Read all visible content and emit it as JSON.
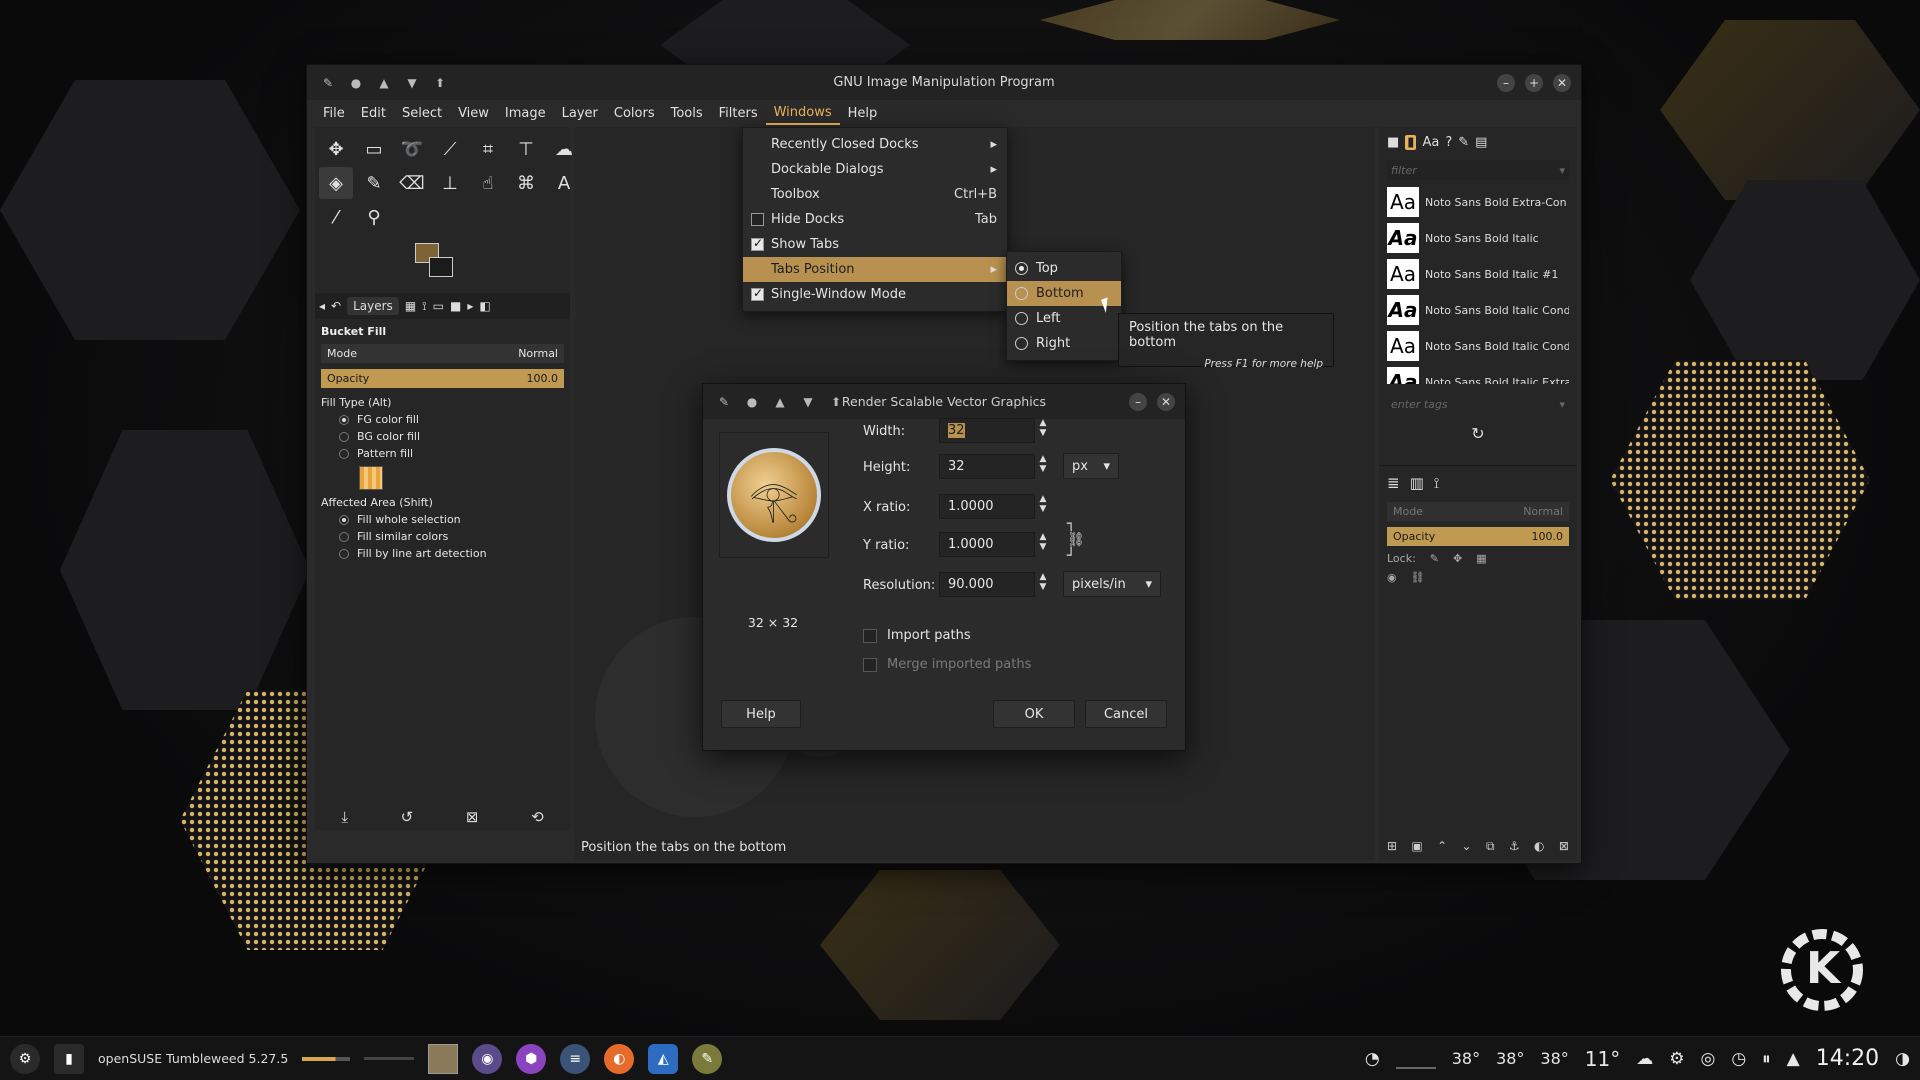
{
  "window": {
    "title": "GNU Image Manipulation Program"
  },
  "menubar": [
    "File",
    "Edit",
    "Select",
    "View",
    "Image",
    "Layer",
    "Colors",
    "Tools",
    "Filters",
    "Windows",
    "Help"
  ],
  "left_dock": {
    "tab_label": "Layers",
    "tool_name": "Bucket Fill",
    "mode_label": "Mode",
    "mode_value": "Normal",
    "opacity_label": "Opacity",
    "opacity_value": "100.0",
    "fill_type_label": "Fill Type  (Alt)",
    "fill_options": [
      "FG color fill",
      "BG color fill",
      "Pattern fill"
    ],
    "affected_label": "Affected Area  (Shift)",
    "affected_options": [
      "Fill whole selection",
      "Fill similar colors",
      "Fill by line art detection"
    ]
  },
  "windows_menu": {
    "items": [
      {
        "label": "Recently Closed Docks",
        "accel": "▸"
      },
      {
        "label": "Dockable Dialogs",
        "accel": "▸"
      },
      {
        "label": "Toolbox",
        "accel": "Ctrl+B"
      },
      {
        "label": "Hide Docks",
        "accel": "Tab"
      },
      {
        "label": "Show Tabs",
        "accel": ""
      },
      {
        "label": "Tabs Position",
        "accel": "▸"
      },
      {
        "label": "Single-Window Mode",
        "accel": ""
      }
    ]
  },
  "tabs_position_submenu": [
    "Top",
    "Bottom",
    "Left",
    "Right"
  ],
  "tooltip": {
    "text": "Position the tabs on the bottom",
    "help": "Press F1 for more help"
  },
  "canvas_status": "Position the tabs on the bottom",
  "fonts_panel": {
    "filter_placeholder": "filter",
    "tags_placeholder": "enter tags",
    "fonts": [
      "Noto Sans Bold Extra-Con",
      "Noto Sans Bold Italic",
      "Noto Sans Bold Italic #1",
      "Noto Sans Bold Italic Cond",
      "Noto Sans Bold Italic Cond",
      "Noto Sans Bold Italic Extra"
    ]
  },
  "layers_panel": {
    "mode_label": "Mode",
    "mode_value": "Normal",
    "opacity_label": "Opacity",
    "opacity_value": "100.0",
    "lock_label": "Lock:"
  },
  "svg_dialog": {
    "title": "Render Scalable Vector Graphics",
    "width_label": "Width:",
    "width_value": "32",
    "height_label": "Height:",
    "height_value": "32",
    "xratio_label": "X ratio:",
    "xratio_value": "1.0000",
    "yratio_label": "Y ratio:",
    "yratio_value": "1.0000",
    "resolution_label": "Resolution:",
    "resolution_value": "90.000",
    "size_unit": "px",
    "res_unit": "pixels/in",
    "preview_dims": "32 × 32",
    "import_paths": "Import paths",
    "merge_paths": "Merge imported paths",
    "help": "Help",
    "ok": "OK",
    "cancel": "Cancel"
  },
  "taskbar": {
    "os_label": "openSUSE Tumbleweed 5.27.5",
    "temps": [
      "38°",
      "38°",
      "38°"
    ],
    "weather": "11°",
    "clock": "14:20"
  }
}
